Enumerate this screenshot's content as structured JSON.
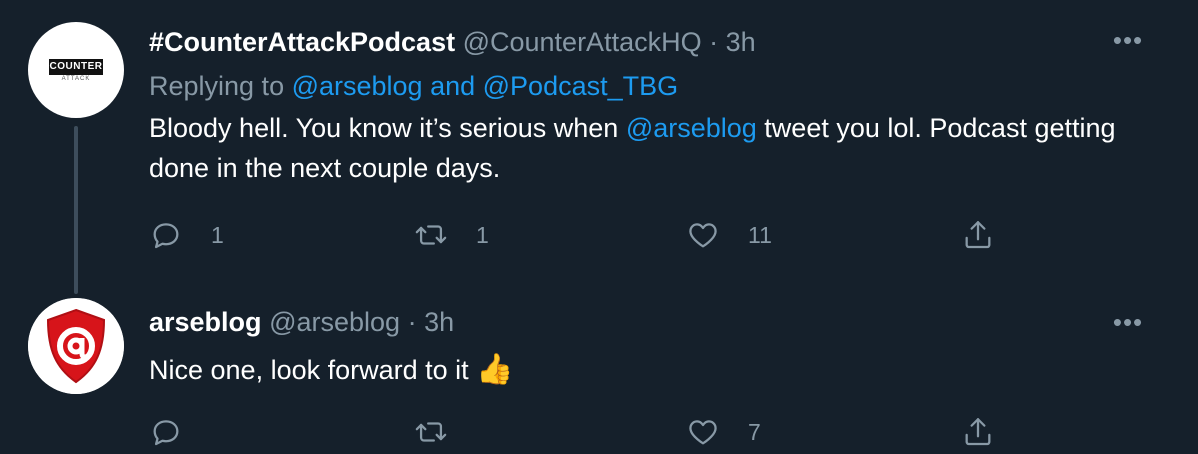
{
  "tweets": [
    {
      "avatar_text": "COUNTER",
      "avatar_subtext": "ATTACK",
      "name": "#CounterAttackPodcast",
      "handle": "@CounterAttackHQ",
      "separator": "·",
      "time": "3h",
      "replying_prefix": "Replying to ",
      "replying_user1": "@arseblog",
      "replying_and": " and ",
      "replying_user2": "@Podcast_TBG",
      "text_part1": "Bloody hell. You know it’s serious when ",
      "text_mention": "@arseblog",
      "text_part2": " tweet you lol. Podcast getting done in the next couple days.",
      "reply_count": "1",
      "retweet_count": "1",
      "like_count": "11",
      "more_label": "•••"
    },
    {
      "avatar_text": "@",
      "name": "arseblog",
      "handle": "@arseblog",
      "separator": "·",
      "time": "3h",
      "text": "Nice one, look forward to it ",
      "emoji": "👍",
      "reply_count": "",
      "retweet_count": "",
      "like_count": "7",
      "more_label": "•••"
    }
  ],
  "colors": {
    "background": "#15202b",
    "secondary_text": "#8899a6",
    "link": "#1d9bf0",
    "thread_line": "#3d4d5c",
    "avatar_red": "#d7141a"
  },
  "icons": [
    "reply-icon",
    "retweet-icon",
    "like-icon",
    "share-icon",
    "more-icon"
  ]
}
